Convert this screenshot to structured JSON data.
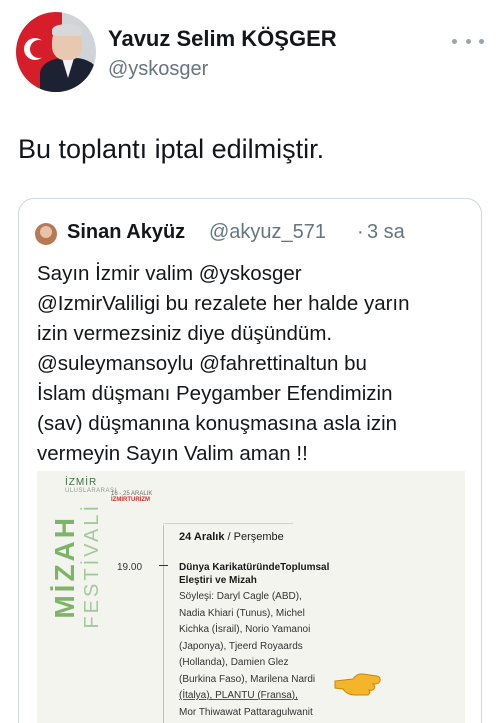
{
  "author": {
    "name": "Yavuz Selim KÖŞGER",
    "handle": "@yskosger"
  },
  "tweet": {
    "text": "Bu toplantı iptal edilmiştir."
  },
  "quoted": {
    "name": "Sinan Akyüz",
    "handle": "@akyuz_571",
    "separator": "·",
    "time": "3 sa",
    "lines": [
      "Sayın İzmir valim @yskosger",
      "@IzmirValiligi bu rezalete her halde yarın",
      "izin vermezsiniz diye düşündüm.",
      "@suleymansoylu @fahrettinaltun bu",
      "İslam düşmanı Peygamber Efendimizin",
      "(sav) düşmanına konuşmasına asla izin",
      "vermeyin Sayın Valim aman !!"
    ]
  },
  "poster": {
    "city": "İZMİR",
    "intl": "ULUSLARARASI",
    "title_mizah": "MİZAH",
    "title_festival": "FESTİVALİ",
    "dates": "16 - 25 ARALIK",
    "brand": "İZMİRTURİZM",
    "day_bold": "24 Aralık",
    "day_rest": " / Perşembe",
    "time": "19.00",
    "event_line1": "Dünya KarikatüründeToplumsal",
    "event_line2": "Eleştiri ve Mizah",
    "speaker_lines": [
      "Söyleşi: Daryl Cagle (ABD),",
      "Nadia Khiari (Tunus), Michel",
      "Kichka (İsrail), Norio Yamanoi",
      "(Japonya), Tjeerd Royaards",
      "(Hollanda), Damien Glez",
      "(Burkina Faso), Marilena Nardi",
      "(İtalya), PLANTU (Fransa),",
      "Mor Thiwawat Pattaragulwanit"
    ]
  },
  "icons": {
    "more": "more-horizontal-icon",
    "pointing": "pointing-hand-icon"
  },
  "colors": {
    "text": "#14171a",
    "muted": "#66757f",
    "border": "#cfd9de",
    "festival_green": "#7fb36a"
  }
}
